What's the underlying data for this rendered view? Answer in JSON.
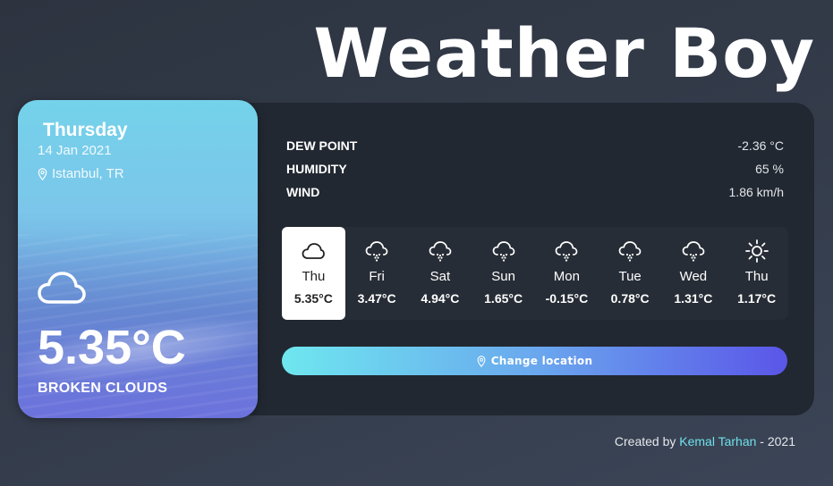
{
  "app": {
    "title": "Weather Boy"
  },
  "today": {
    "day": "Thursday",
    "date": "14 Jan 2021",
    "location": "Istanbul, TR",
    "icon": "cloud-icon",
    "temperature": "5.35°C",
    "condition": "BROKEN CLOUDS"
  },
  "stats": [
    {
      "label": "DEW POINT",
      "value": "-2.36 °C"
    },
    {
      "label": "HUMIDITY",
      "value": "65 %"
    },
    {
      "label": "WIND",
      "value": "1.86 km/h"
    }
  ],
  "forecast": [
    {
      "day": "Thu",
      "temp": "5.35°C",
      "icon": "cloud-icon",
      "active": true
    },
    {
      "day": "Fri",
      "temp": "3.47°C",
      "icon": "snow-icon"
    },
    {
      "day": "Sat",
      "temp": "4.94°C",
      "icon": "snow-icon"
    },
    {
      "day": "Sun",
      "temp": "1.65°C",
      "icon": "snow-icon"
    },
    {
      "day": "Mon",
      "temp": "-0.15°C",
      "icon": "snow-icon"
    },
    {
      "day": "Tue",
      "temp": "0.78°C",
      "icon": "snow-icon"
    },
    {
      "day": "Wed",
      "temp": "1.31°C",
      "icon": "snow-icon"
    },
    {
      "day": "Thu",
      "temp": "1.17°C",
      "icon": "sun-icon"
    }
  ],
  "actions": {
    "change_location": "Change location"
  },
  "footer": {
    "prefix": "Created by",
    "author": "Kemal Tarhan",
    "suffix": "- 2021"
  },
  "colors": {
    "accent_start": "#6ee7ef",
    "accent_end": "#5a56e8",
    "author_link": "#6ee0ea"
  }
}
